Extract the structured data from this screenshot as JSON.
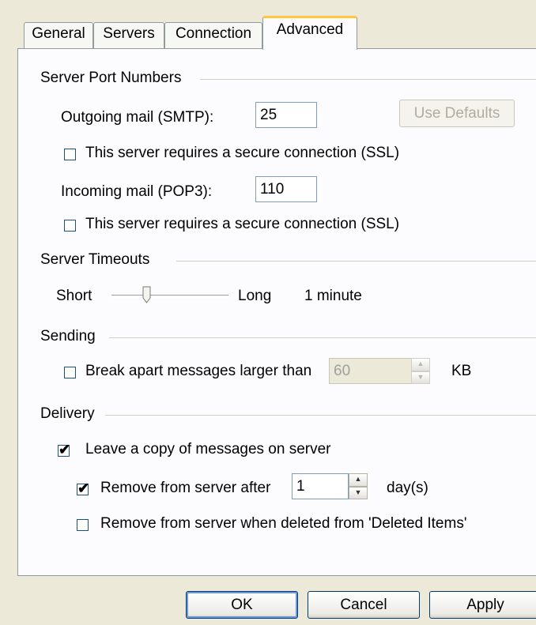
{
  "tabs": [
    {
      "label": "General"
    },
    {
      "label": "Servers"
    },
    {
      "label": "Connection"
    },
    {
      "label": "Advanced"
    }
  ],
  "ports": {
    "group_title": "Server Port Numbers",
    "smtp_label": "Outgoing mail (SMTP):",
    "smtp_value": "25",
    "use_defaults_label": "Use Defaults",
    "smtp_ssl_label": "This server requires a secure connection (SSL)",
    "smtp_ssl_checked": false,
    "pop3_label": "Incoming mail (POP3):",
    "pop3_value": "110",
    "pop3_ssl_label": "This server requires a secure connection (SSL)",
    "pop3_ssl_checked": false
  },
  "timeouts": {
    "group_title": "Server Timeouts",
    "short_label": "Short",
    "long_label": "Long",
    "value_label": "1 minute",
    "slider_fraction": 0.15
  },
  "sending": {
    "group_title": "Sending",
    "break_label": "Break apart messages larger than",
    "break_checked": false,
    "break_value": "60",
    "unit_label": "KB"
  },
  "delivery": {
    "group_title": "Delivery",
    "leave_copy_label": "Leave a copy of messages on server",
    "leave_copy_checked": true,
    "remove_after_label": "Remove from server after",
    "remove_after_checked": true,
    "remove_after_value": "1",
    "days_label": "day(s)",
    "remove_deleted_label": "Remove from server when deleted from 'Deleted Items'",
    "remove_deleted_checked": false
  },
  "footer": {
    "ok_label": "OK",
    "cancel_label": "Cancel",
    "apply_label": "Apply"
  },
  "colors": {
    "dialog_bg": "#ece9d8",
    "panel_bg": "#fcfcfe",
    "tab_highlight": "#ffc83c",
    "check_mark": "#000000"
  }
}
